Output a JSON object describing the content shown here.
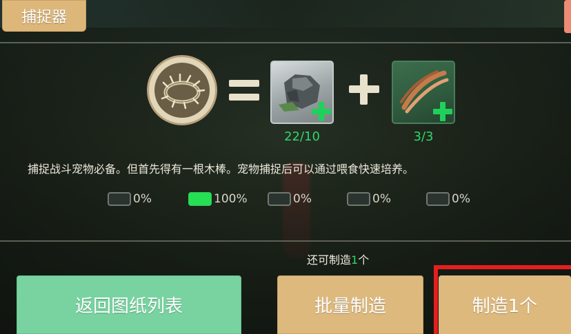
{
  "colors": {
    "accent_gold": "#ddb97e",
    "accent_green_button": "#78d3a0",
    "count_green": "#2fd86a",
    "quality_active": "#26e054",
    "highlight_red": "#e51e1e"
  },
  "header": {
    "title": "捕捉器"
  },
  "recipe": {
    "result_icon": "thorn-ring-icon",
    "equals_icon": "equals-icon",
    "plus_icon": "plus-icon",
    "materials": [
      {
        "icon": "stone-ore-icon",
        "count": "22/10"
      },
      {
        "icon": "wooden-stick-icon",
        "count": "3/3"
      }
    ]
  },
  "description": "捕捉战斗宠物必备。但首先得有一根木棒。宠物捕捉后可以通过喂食快速培养。",
  "quality": [
    {
      "percent": "0%",
      "active": false
    },
    {
      "percent": "100%",
      "active": true
    },
    {
      "percent": "0%",
      "active": false
    },
    {
      "percent": "0%",
      "active": false
    },
    {
      "percent": "0%",
      "active": false
    }
  ],
  "remaining": {
    "prefix": "还可制造",
    "count": "1",
    "suffix": "个"
  },
  "buttons": {
    "back": "返回图纸列表",
    "batch": "批量制造",
    "make_one": "制造1个"
  }
}
